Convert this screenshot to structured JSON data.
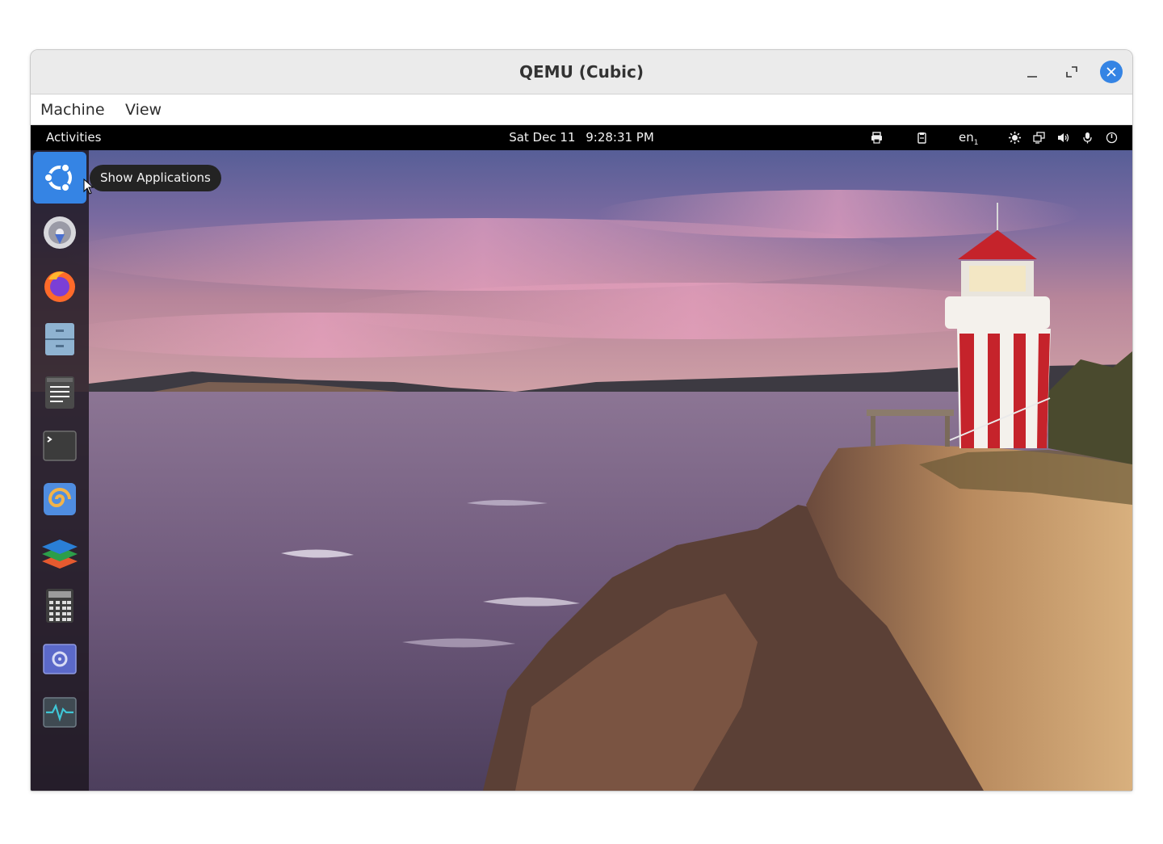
{
  "window": {
    "title": "QEMU (Cubic)",
    "controls": [
      "minimize",
      "maximize",
      "close"
    ],
    "accent": "#3584e4"
  },
  "menubar": {
    "items": [
      "Machine",
      "View"
    ]
  },
  "guest": {
    "topbar": {
      "activities": "Activities",
      "date": "Sat Dec 11",
      "time": "9:28:31 PM",
      "keyboard_layout": "en",
      "keyboard_layout_sub": "1",
      "tray_icons": [
        "printer-icon",
        "clipboard-icon",
        "brightness-icon",
        "display-icon",
        "volume-icon",
        "microphone-icon",
        "power-icon"
      ]
    },
    "dock": {
      "items": [
        {
          "name": "show-applications",
          "icon": "ubuntu-logo-icon",
          "active": true
        },
        {
          "name": "installer",
          "icon": "installer-icon"
        },
        {
          "name": "firefox",
          "icon": "firefox-icon"
        },
        {
          "name": "files",
          "icon": "file-cabinet-icon"
        },
        {
          "name": "text-editor",
          "icon": "text-editor-icon"
        },
        {
          "name": "terminal",
          "icon": "terminal-icon"
        },
        {
          "name": "swirl-app",
          "icon": "swirl-icon"
        },
        {
          "name": "layers-app",
          "icon": "layers-icon"
        },
        {
          "name": "calculator",
          "icon": "calculator-icon"
        },
        {
          "name": "disk-app",
          "icon": "disk-icon"
        },
        {
          "name": "system-monitor",
          "icon": "system-monitor-icon"
        }
      ]
    },
    "tooltip": "Show Applications",
    "wallpaper": "lighthouse-coast-sunset"
  }
}
